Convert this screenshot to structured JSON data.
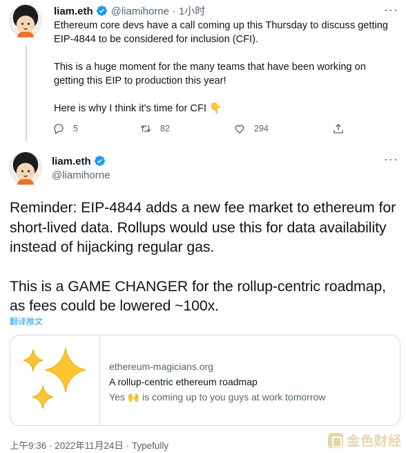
{
  "tweet1": {
    "name": "liam.eth",
    "handle": "@liamihorne",
    "separator": "·",
    "time": "1小时",
    "more": "···",
    "paragraphs": [
      "Ethereum core devs have a call coming up this Thursday to discuss getting EIP-4844 to be considered for inclusion (CFI).",
      "This is a huge moment for the many teams that have been working on getting this EIP to production this year!",
      "Here is why I think it's time for CFI 👇"
    ],
    "replies": "5",
    "retweets": "82",
    "likes": "294"
  },
  "tweet2": {
    "name": "liam.eth",
    "handle": "@liamihorne",
    "more": "···",
    "paragraphs": [
      "Reminder: EIP-4844 adds a new fee market to ethereum for short-lived data. Rollups would use this for data availability instead of hijacking regular gas.",
      "This is a GAME CHANGER for the rollup-centric roadmap, as fees could be lowered ~100x."
    ],
    "translate": "翻译推文",
    "card": {
      "domain": "ethereum-magicians.org",
      "title": "A rollup-centric ethereum roadmap",
      "description": "Yes 🙌 is coming up to you guys at work tomorrow"
    },
    "footer": "上午9:36 · 2022年11月24日 · Typefully"
  },
  "watermark": {
    "text": "金色财经"
  },
  "colors": {
    "accent": "#1d9bf0",
    "muted": "#536471",
    "border": "#cfd9de",
    "sparkle": "#fbc531"
  },
  "icons": [
    "verified-badge-icon",
    "reply-icon",
    "retweet-icon",
    "like-icon",
    "share-icon",
    "sparkles-icon",
    "more-icon"
  ]
}
